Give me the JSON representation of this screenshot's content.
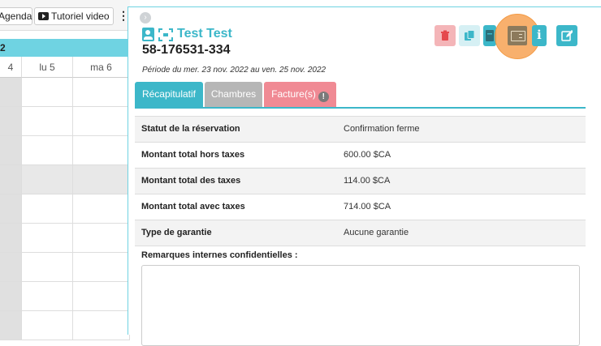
{
  "toolbar": {
    "agenda_label": "Agenda",
    "video_label": "Tutoriel video",
    "more_label": "⋮"
  },
  "calendar": {
    "week_label": "2",
    "days": [
      "4",
      "lu 5",
      "ma 6"
    ]
  },
  "reservation": {
    "client_name": "Test Test",
    "number": "58-176531-334",
    "period": "Période du mer. 23 nov. 2022 au ven. 25 nov. 2022",
    "actions": [
      "delete-icon",
      "copy-icon",
      "document-icon",
      "credit-card-icon",
      "info-icon",
      "edit-icon"
    ],
    "info_label": "i"
  },
  "tabs": [
    {
      "label": "Récapitulatif"
    },
    {
      "label": "Chambres"
    },
    {
      "label": "Facture(s)",
      "badge": "!"
    }
  ],
  "summary": {
    "rows": [
      {
        "label": "Statut de la réservation",
        "value": "Confirmation ferme"
      },
      {
        "label": "Montant total hors taxes",
        "value": "600.00 $CA"
      },
      {
        "label": "Montant total des taxes",
        "value": "114.00 $CA"
      },
      {
        "label": "Montant total avec taxes",
        "value": "714.00 $CA"
      },
      {
        "label": "Type de garantie",
        "value": "Aucune garantie"
      }
    ],
    "remarks_label": "Remarques internes confidentielles :"
  },
  "colors": {
    "accent": "#3cb7c9",
    "danger_light": "#f4b5b8",
    "invoice_tab": "#f08a94",
    "highlight": "#f6963c"
  }
}
